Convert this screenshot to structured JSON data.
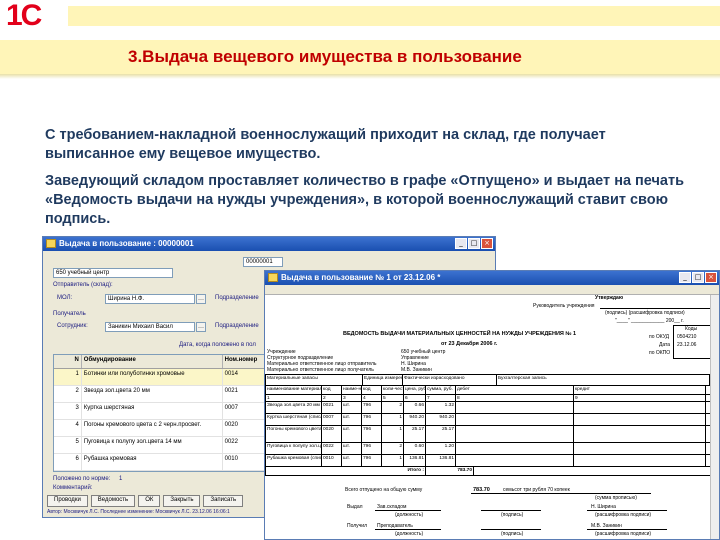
{
  "logo": "1С",
  "slide_title": "3.Выдача вещевого имущества в пользование",
  "paragraph1": "С требованием-накладной военнослужащий приходит на склад, где получает выписанное ему вещевое имущество.",
  "paragraph2": "Заведующий складом проставляет количество в графе «Отпущено»             и выдает на печать «Ведомость выдачи на нужды учреждения», в которой военнослужащий ставит свою подпись.",
  "colors": {
    "accent": "#c00000",
    "band": "#fff5b8",
    "text": "#1f3a5f"
  },
  "window1": {
    "title": "Выдача в пользование : 00000001",
    "org": "650 учебный центр",
    "number": "00000001",
    "sender_label": "Отправитель (склад):",
    "mol_label": "МОЛ:",
    "mol_value": "Ширина Н.Ф.",
    "dept_label": "Подразделение",
    "receiver_label": "Получатель",
    "employee_label": "Сотрудник:",
    "employee_value": "Заникин Михаил Васил",
    "date_label": "Дата, когда положено в пол",
    "columns": [
      "N",
      "Обмундирование",
      "Ном.номер"
    ],
    "rows": [
      {
        "n": "1",
        "name": "Ботинки или полуботинки хромовые",
        "code": "0014"
      },
      {
        "n": "2",
        "name": "Звезда зол.цвета 20 мм",
        "code": "0021"
      },
      {
        "n": "3",
        "name": "Куртка шерстяная",
        "code": "0007"
      },
      {
        "n": "4",
        "name": "Погоны кремового цвета с 2 черн.просвет.",
        "code": "0020"
      },
      {
        "n": "5",
        "name": "Пуговица к полупу зол.цвета 14 мм",
        "code": "0022"
      },
      {
        "n": "6",
        "name": "Рубашка кремовая",
        "code": "0010"
      }
    ],
    "norm_label": "Положено по норме:",
    "norm_value": "1",
    "comment_label": "Комментарий:",
    "buttons": [
      "Проводки",
      "Ведомость",
      "ОК",
      "Закрыть",
      "Записать"
    ],
    "status": "Автор: Москвичук Л.С. Последнее изменение: Москвичук Л.С. 23.12.06 16:06:1"
  },
  "window2": {
    "title": "Выдача в пользование № 1 от 23.12.06 *",
    "approve": "Утверждаю",
    "head_label": "Руководитель учреждения",
    "sign_caption": "(подпись)       (расшифровка подписи)",
    "date_line": "\"____\" ____________ 200__ г.",
    "codes_label": "Коды",
    "okud_label": "по ОКУД",
    "okud": "0504210",
    "date_label": "Дата",
    "date_value": "23.12.06",
    "okpo_label": "по ОКПО",
    "doc_title": "ВЕДОМОСТЬ ВЫДАЧИ МАТЕРИАЛЬНЫХ ЦЕННОСТЕЙ НА НУЖДЫ УЧРЕЖДЕНИЯ № 1",
    "doc_date": "от 23 Декабря 2006 г.",
    "fields": [
      {
        "label": "Учреждение",
        "value": "650 учебный центр"
      },
      {
        "label": "Структурное подразделение",
        "value": "Управление"
      },
      {
        "label": "Материально ответственное лицо отправитель",
        "value": "Н. Ширина"
      },
      {
        "label": "Материально ответственное лицо получатель",
        "value": "М.В. Заникин"
      }
    ],
    "header1": [
      "Материальные запасы",
      "Единица измерения",
      "Фактически израсходовано",
      "Бухгалтерская запись"
    ],
    "header2": [
      "наименование материала",
      "код",
      "наиме-нование",
      "код",
      "коли-чество",
      "цена, руб.",
      "сумма, руб.",
      "дебет",
      "кредит"
    ],
    "header3": [
      "1",
      "2",
      "3",
      "4",
      "5",
      "6",
      "7",
      "8",
      "9"
    ],
    "rows": [
      [
        "Звезда зол.цвета 20 мм (списано при выдаче)",
        "0021",
        "шт.",
        "796",
        "2",
        "0.66",
        "1.32",
        "",
        ""
      ],
      [
        "Куртка шерстяная (списано при выдаче)",
        "0007",
        "шт.",
        "796",
        "1",
        "940.20",
        "940.20",
        "",
        ""
      ],
      [
        "Погоны кремового цвета с двумя черными просветами (списано при выдаче)",
        "0020",
        "шт.",
        "796",
        "1",
        "25.17",
        "25.17",
        "",
        ""
      ],
      [
        "Пуговица к полупу зол.цвета 14 мм (списано при выдаче)",
        "0022",
        "шт.",
        "796",
        "2",
        "0.60",
        "1.20",
        "",
        ""
      ],
      [
        "Рубашка кремовая (списано при выдаче)",
        "0010",
        "шт.",
        "796",
        "1",
        "136.81",
        "136.81",
        "",
        ""
      ]
    ],
    "total_label": "Итого :",
    "total_value": "783.70",
    "total_words_label": "Всего отпущено на общую сумму",
    "total_words_value": "783.70",
    "total_words_text": "семьсот три рубля 70 копеек",
    "sum_caption": "(сумма прописью)",
    "issued_label": "Выдал",
    "issued_position": "Зав.складом",
    "issued_name": "Н. Ширина",
    "received_label": "Получил",
    "received_position": "Преподаватель",
    "received_name": "М.В. Заникин",
    "caption_position": "(должность)",
    "caption_sign": "(подпись)",
    "caption_decode": "(расшифровка подписи)"
  }
}
